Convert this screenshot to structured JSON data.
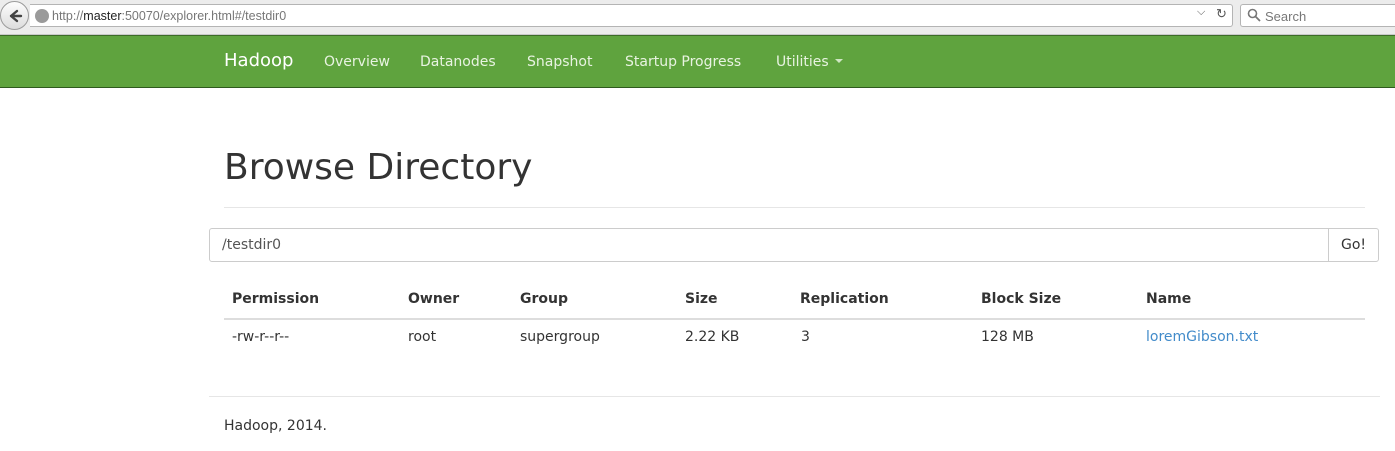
{
  "browser": {
    "url_prefix": "http://",
    "url_host": "master",
    "url_rest": ":50070/explorer.html#/testdir0",
    "search_placeholder": "Search"
  },
  "navbar": {
    "brand": "Hadoop",
    "items": [
      "Overview",
      "Datanodes",
      "Snapshot",
      "Startup Progress",
      "Utilities"
    ],
    "color": "#5fa33e"
  },
  "page": {
    "title": "Browse Directory"
  },
  "path": {
    "value": "/testdir0",
    "go_label": "Go!"
  },
  "table": {
    "headers": [
      "Permission",
      "Owner",
      "Group",
      "Size",
      "Replication",
      "Block Size",
      "Name"
    ],
    "rows": [
      {
        "permission": "-rw-r--r--",
        "owner": "root",
        "group": "supergroup",
        "size": "2.22 KB",
        "replication": "3",
        "block_size": "128 MB",
        "name": "loremGibson.txt"
      }
    ],
    "link_color": "#428bca"
  },
  "footer": {
    "text": "Hadoop, 2014."
  }
}
